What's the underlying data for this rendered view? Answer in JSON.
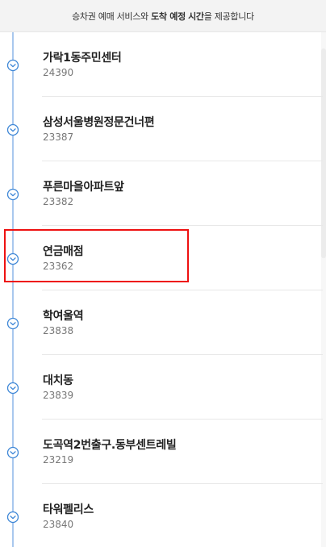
{
  "banner": {
    "part1": "승차권 예매 서비스와",
    "bold1": "도착 예정",
    "bold2": "시간",
    "part2": "을 제공합니다"
  },
  "icons": {
    "stop_marker": "chevron-down-circle-icon"
  },
  "colors": {
    "timeline": "#a9c8ee",
    "marker": "#3d86d6",
    "highlight": "#ee1111"
  },
  "stops": [
    {
      "name": "가락1동주민센터",
      "number": "24390"
    },
    {
      "name": "삼성서울병원정문건너편",
      "number": "23387"
    },
    {
      "name": "푸른마을아파트앞",
      "number": "23382"
    },
    {
      "name": "연금매점",
      "number": "23362"
    },
    {
      "name": "학여울역",
      "number": "23838"
    },
    {
      "name": "대치동",
      "number": "23839"
    },
    {
      "name": "도곡역2번출구.동부센트레빌",
      "number": "23219"
    },
    {
      "name": "타워펠리스",
      "number": "23840"
    }
  ]
}
